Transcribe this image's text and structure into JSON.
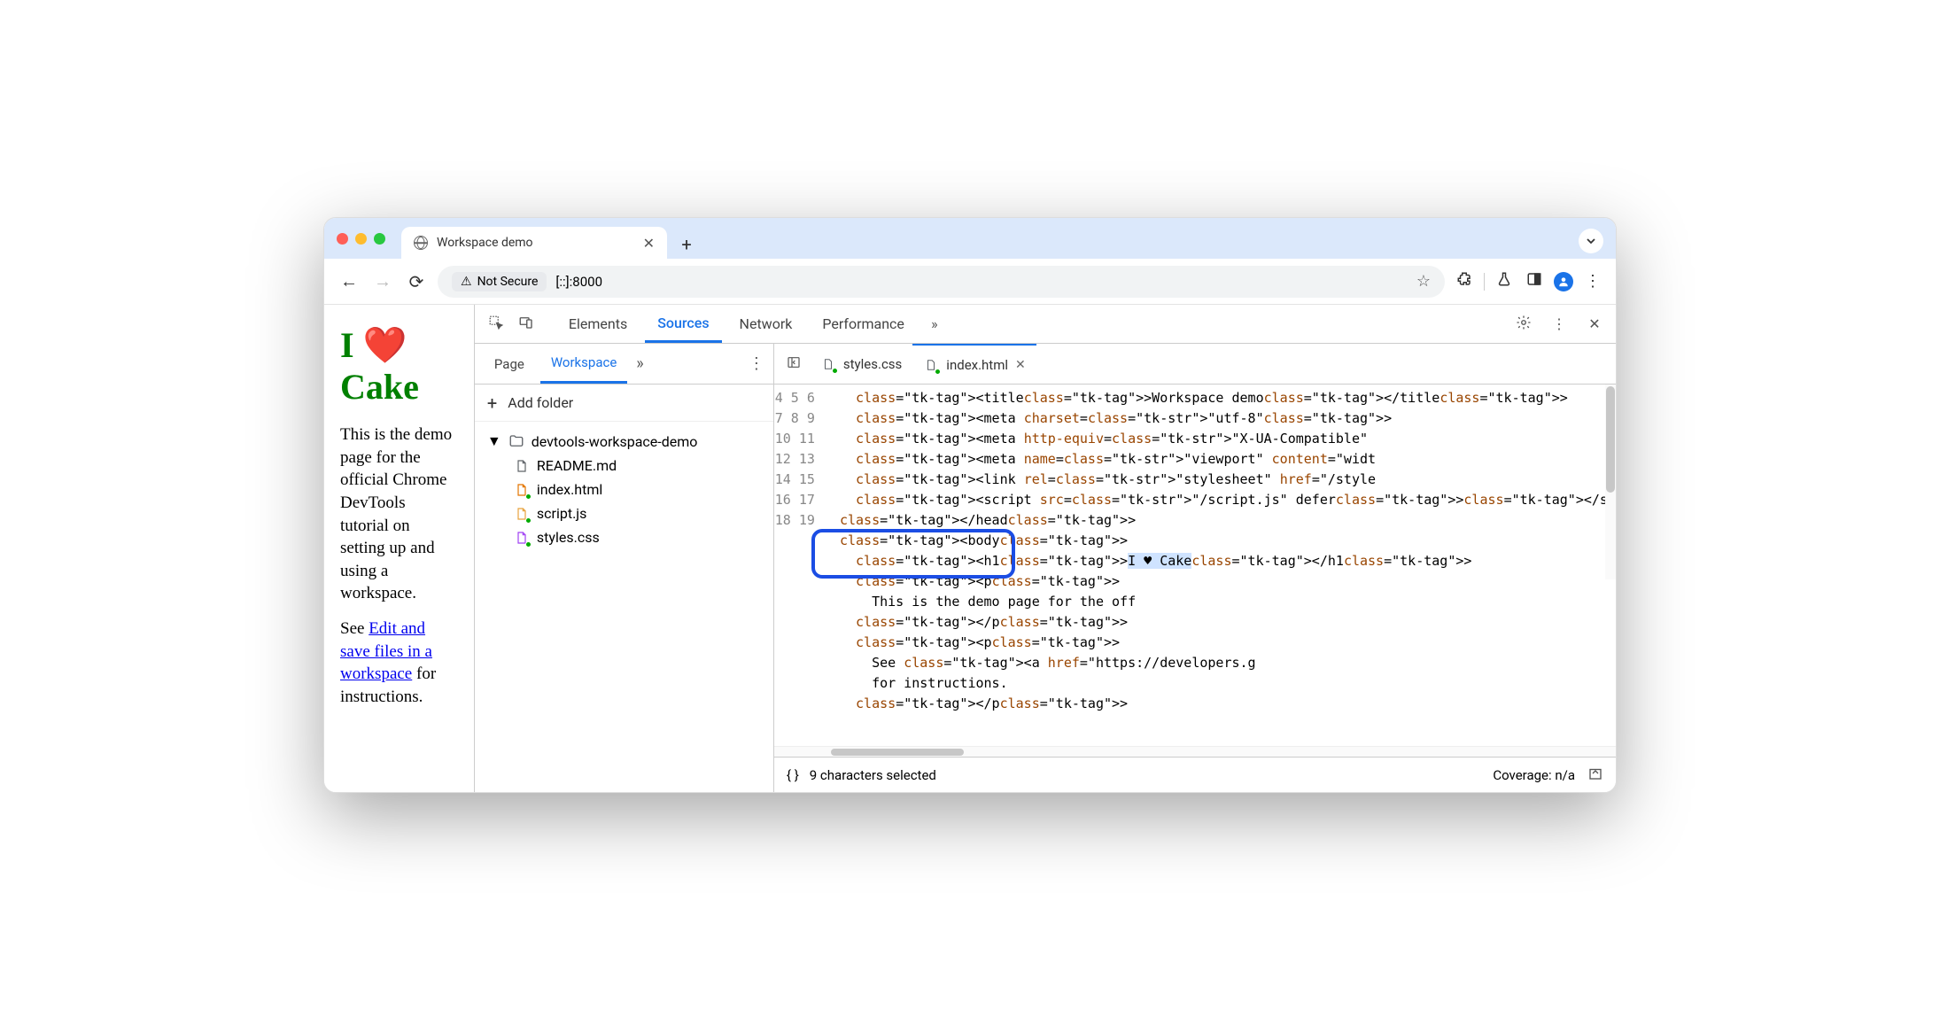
{
  "browser": {
    "tab_title": "Workspace demo",
    "security_label": "Not Secure",
    "url": "[::]:8000"
  },
  "page": {
    "h1_html": "I ❤️ Cake",
    "p1": "This is the demo page for the official Chrome DevTools tutorial on setting up and using a workspace.",
    "p2_prefix": "See ",
    "p2_link": "Edit and save files in a workspace",
    "p2_suffix": " for instructions."
  },
  "devtools": {
    "tabs": [
      "Elements",
      "Sources",
      "Network",
      "Performance"
    ],
    "active_tab": "Sources",
    "nav": {
      "tabs": [
        "Page",
        "Workspace"
      ],
      "active": "Workspace",
      "add_folder": "Add folder",
      "folder": "devtools-workspace-demo",
      "files": [
        {
          "name": "README.md",
          "color": "#5f6368",
          "dot": false
        },
        {
          "name": "index.html",
          "color": "#e37400",
          "dot": true
        },
        {
          "name": "script.js",
          "color": "#e8a23d",
          "dot": true
        },
        {
          "name": "styles.css",
          "color": "#a142f4",
          "dot": true
        }
      ]
    },
    "editor": {
      "tabs": [
        {
          "name": "styles.css",
          "dot": true,
          "active": false
        },
        {
          "name": "index.html",
          "dot": true,
          "active": true
        }
      ],
      "first_line_no": 4,
      "lines": [
        "    <title>Workspace demo</title>",
        "    <meta charset=\"utf-8\">",
        "    <meta http-equiv=\"X-UA-Compatible\" ",
        "    <meta name=\"viewport\" content=\"widt",
        "    <link rel=\"stylesheet\" href=\"/style",
        "    <script src=\"/script.js\" defer></sc",
        "  </head>",
        "  <body>",
        "    <h1>I ♥ Cake</h1>",
        "    <p>",
        "      This is the demo page for the off",
        "    </p>",
        "    <p>",
        "      See <a href=\"https://developers.g",
        "      for instructions.",
        "    </p>"
      ],
      "highlighted_line_index": 8,
      "selection_text": "I ♥ Cake"
    },
    "status": {
      "selection": "9 characters selected",
      "coverage": "Coverage: n/a"
    }
  }
}
